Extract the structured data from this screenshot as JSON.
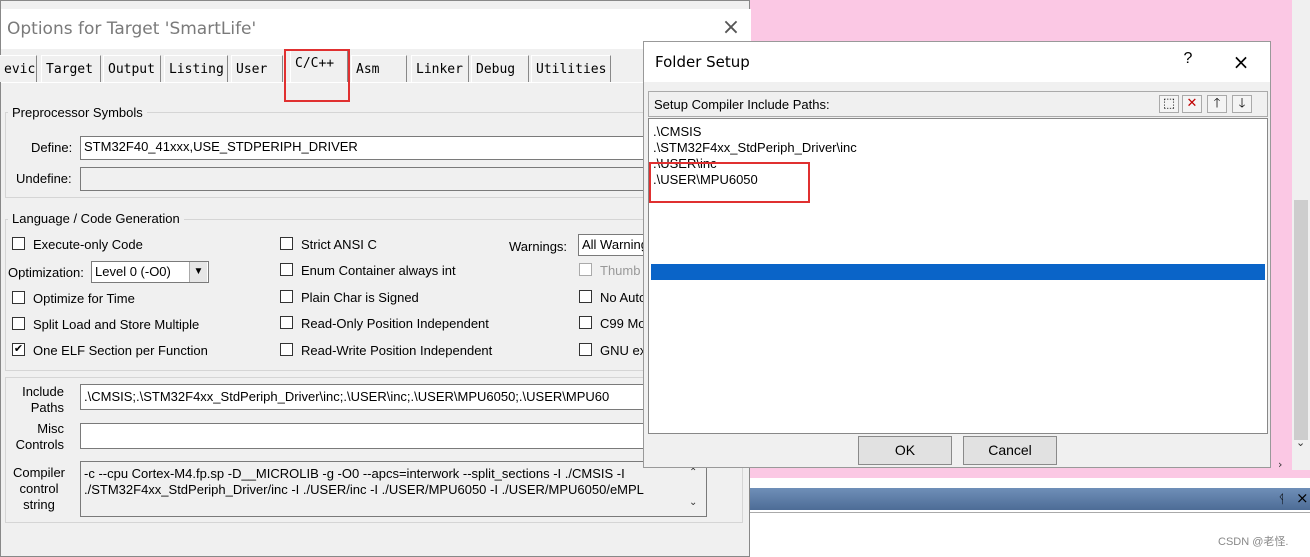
{
  "main_dialog": {
    "title": "Options for Target 'SmartLife'",
    "close": "×",
    "tabs": [
      {
        "label": "evice"
      },
      {
        "label": "Target"
      },
      {
        "label": "Output"
      },
      {
        "label": "Listing"
      },
      {
        "label": "User"
      },
      {
        "label": "C/C++"
      },
      {
        "label": "Asm"
      },
      {
        "label": "Linker"
      },
      {
        "label": "Debug"
      },
      {
        "label": "Utilities"
      }
    ],
    "preprocessor": {
      "group_label": "Preprocessor Symbols",
      "define_label": "Define:",
      "define_value": "STM32F40_41xxx,USE_STDPERIPH_DRIVER",
      "undefine_label": "Undefine:",
      "undefine_value": ""
    },
    "language": {
      "group_label": "Language / Code Generation",
      "execute_only": "Execute-only Code",
      "optimization_label": "Optimization:",
      "optimization_value": "Level 0 (-O0)",
      "optimize_time": "Optimize for Time",
      "split_load": "Split Load and Store Multiple",
      "one_elf": "One ELF Section per Function",
      "strict_ansi": "Strict ANSI C",
      "enum_container": "Enum Container always int",
      "plain_char": "Plain Char is Signed",
      "ro_pos": "Read-Only Position Independent",
      "rw_pos": "Read-Write Position Independent",
      "warnings_label": "Warnings:",
      "warnings_value": "All Warning",
      "thumb": "Thumb",
      "no_auto": "No Auto",
      "c99": "C99 Mo",
      "gnu": "GNU ex",
      "check": "✔"
    },
    "include_label": "Include\nPaths",
    "include_value": ".\\CMSIS;.\\STM32F4xx_StdPeriph_Driver\\inc;.\\USER\\inc;.\\USER\\MPU6050;.\\USER\\MPU60",
    "misc_label": "Misc\nControls",
    "misc_value": "",
    "compiler_label": "Compiler\ncontrol\nstring",
    "compiler_line1": "-c --cpu Cortex-M4.fp.sp -D__MICROLIB -g -O0 --apcs=interwork --split_sections -I ./CMSIS -I",
    "compiler_line2": "./STM32F4xx_StdPeriph_Driver/inc -I ./USER/inc -I ./USER/MPU6050 -I ./USER/MPU6050/eMPL"
  },
  "folder_setup": {
    "title": "Folder Setup",
    "help": "?",
    "close": "×",
    "header_label": "Setup Compiler Include Paths:",
    "toolbar": {
      "new": "⬚",
      "delete": "✕",
      "up": "🡑",
      "down": "🡓"
    },
    "paths": [
      ".\\CMSIS",
      ".\\STM32F4xx_StdPeriph_Driver\\inc",
      ".\\USER\\inc",
      ".\\USER\\MPU6050",
      ""
    ],
    "ok": "OK",
    "cancel": "Cancel"
  },
  "background": {
    "watermark": "CSDN @老怪.",
    "pin": "ᛩ",
    "close": "×"
  },
  "colors": {
    "selection": "#0a64c8",
    "highlight_box": "#e03030",
    "pink_bg": "#fbc8e4"
  }
}
